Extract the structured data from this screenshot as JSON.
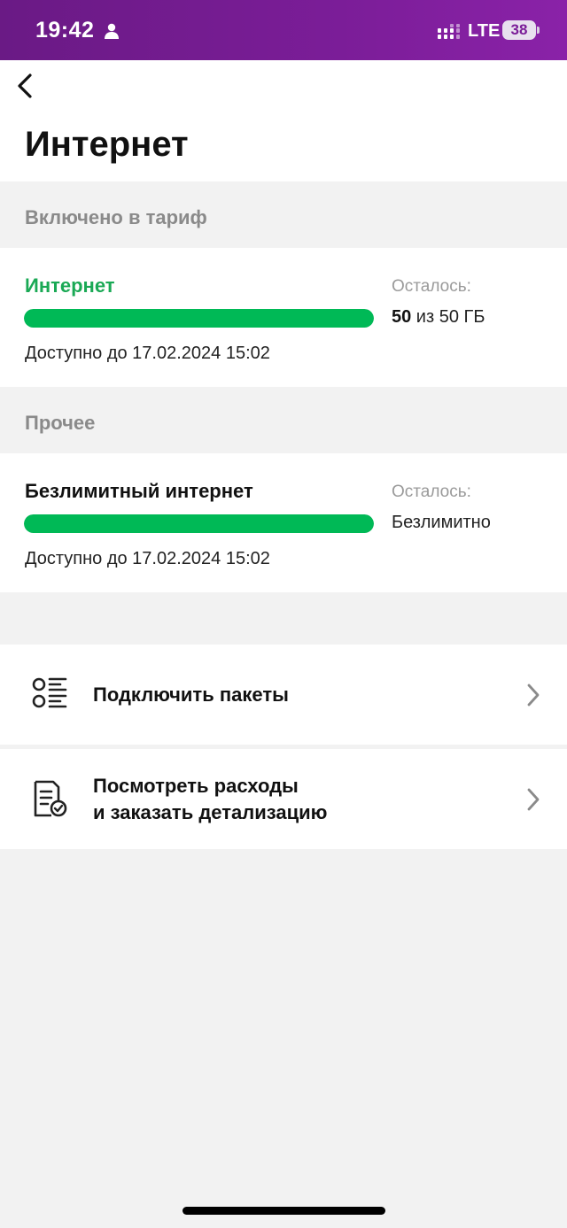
{
  "status_bar": {
    "time": "19:42",
    "network": "LTE",
    "battery": "38",
    "gradient_start": "#6a1a85",
    "gradient_end": "#8a22a8",
    "icons": [
      "person-icon",
      "signal-icon",
      "battery-icon"
    ]
  },
  "header": {
    "back_icon": "chevron-left-icon",
    "title": "Интернет"
  },
  "included_section": {
    "header": "Включено в тариф",
    "item": {
      "name": "Интернет",
      "name_color": "#1aa955",
      "progress_fraction": 1.0,
      "valid_until": "Доступно до 17.02.2024 15:02",
      "remaining_label": "Осталось:",
      "remaining_amount": "50",
      "remaining_total": " из 50 ГБ"
    }
  },
  "other_section": {
    "header": "Прочее",
    "item": {
      "name": "Безлимитный интернет",
      "progress_fraction": 1.0,
      "valid_until": "Доступно до 17.02.2024 15:02",
      "remaining_label": "Осталось:",
      "remaining_value": "Безлимитно"
    }
  },
  "actions": [
    {
      "icon": "list-options-icon",
      "label_line1": "Подключить пакеты",
      "label_line2": ""
    },
    {
      "icon": "document-check-icon",
      "label_line1": "Посмотреть расходы",
      "label_line2": "и заказать детализацию"
    }
  ],
  "colors": {
    "accent_green": "#00b956",
    "brand_purple": "#7b1d98"
  }
}
